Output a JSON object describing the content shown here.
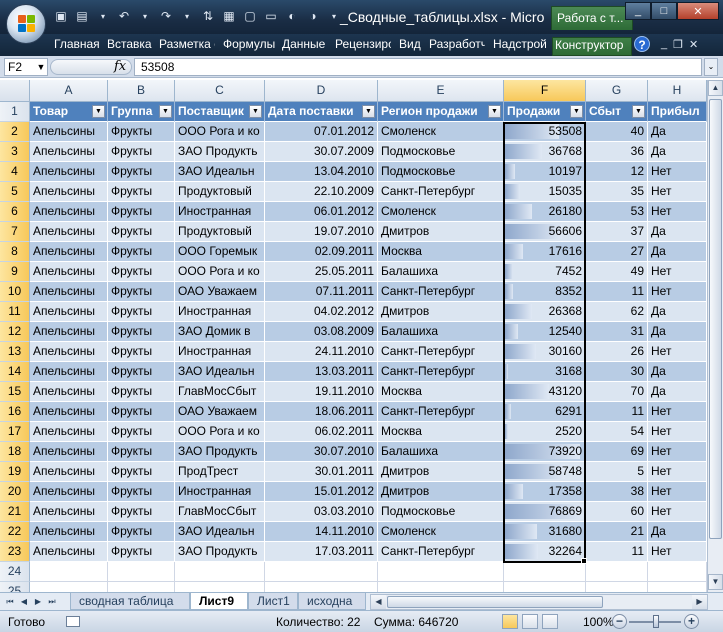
{
  "window": {
    "title": "_Сводные_таблицы.xlsx - Micro",
    "context_tab_title": "Работа с т..."
  },
  "ribbon": {
    "tabs": [
      "Главная",
      "Вставка",
      "Разметка с",
      "Формулы",
      "Данные",
      "Рецензиро",
      "Вид",
      "Разработч",
      "Надстрой",
      "Конструктор"
    ],
    "help": "?"
  },
  "formula_bar": {
    "name_box": "F2",
    "fx": "fx",
    "value": "53508"
  },
  "columns": [
    "A",
    "B",
    "C",
    "D",
    "E",
    "F",
    "G",
    "H"
  ],
  "table": {
    "headers": [
      "Товар",
      "Группа",
      "Поставщик",
      "Дата поставки",
      "Регион продажи",
      "Продажи",
      "Сбыт",
      "Прибыл"
    ],
    "rows": [
      [
        "Апельсины",
        "Фрукты",
        "ООО Рога и ко",
        "07.01.2012",
        "Смоленск",
        "53508",
        "40",
        "Да"
      ],
      [
        "Апельсины",
        "Фрукты",
        "ЗАО Продукть",
        "30.07.2009",
        "Подмосковье",
        "36768",
        "36",
        "Да"
      ],
      [
        "Апельсины",
        "Фрукты",
        "ЗАО Идеальн",
        "13.04.2010",
        "Подмосковье",
        "10197",
        "12",
        "Нет"
      ],
      [
        "Апельсины",
        "Фрукты",
        "Продуктовый",
        "22.10.2009",
        "Санкт-Петербург",
        "15035",
        "35",
        "Нет"
      ],
      [
        "Апельсины",
        "Фрукты",
        "Иностранная",
        "06.01.2012",
        "Смоленск",
        "26180",
        "53",
        "Нет"
      ],
      [
        "Апельсины",
        "Фрукты",
        "Продуктовый",
        "19.07.2010",
        "Дмитров",
        "56606",
        "37",
        "Да"
      ],
      [
        "Апельсины",
        "Фрукты",
        "ООО Горемык",
        "02.09.2011",
        "Москва",
        "17616",
        "27",
        "Да"
      ],
      [
        "Апельсины",
        "Фрукты",
        "ООО Рога и ко",
        "25.05.2011",
        "Балашиха",
        "7452",
        "49",
        "Нет"
      ],
      [
        "Апельсины",
        "Фрукты",
        "ОАО Уважаем",
        "07.11.2011",
        "Санкт-Петербург",
        "8352",
        "11",
        "Нет"
      ],
      [
        "Апельсины",
        "Фрукты",
        "Иностранная",
        "04.02.2012",
        "Дмитров",
        "26368",
        "62",
        "Да"
      ],
      [
        "Апельсины",
        "Фрукты",
        "ЗАО Домик в",
        "03.08.2009",
        "Балашиха",
        "12540",
        "31",
        "Да"
      ],
      [
        "Апельсины",
        "Фрукты",
        "Иностранная",
        "24.11.2010",
        "Санкт-Петербург",
        "30160",
        "26",
        "Нет"
      ],
      [
        "Апельсины",
        "Фрукты",
        "ЗАО Идеальн",
        "13.03.2011",
        "Санкт-Петербург",
        "3168",
        "30",
        "Да"
      ],
      [
        "Апельсины",
        "Фрукты",
        "ГлавМосСбыт",
        "19.11.2010",
        "Москва",
        "43120",
        "70",
        "Да"
      ],
      [
        "Апельсины",
        "Фрукты",
        "ОАО Уважаем",
        "18.06.2011",
        "Санкт-Петербург",
        "6291",
        "11",
        "Нет"
      ],
      [
        "Апельсины",
        "Фрукты",
        "ООО Рога и ко",
        "06.02.2011",
        "Москва",
        "2520",
        "54",
        "Нет"
      ],
      [
        "Апельсины",
        "Фрукты",
        "ЗАО Продукть",
        "30.07.2010",
        "Балашиха",
        "73920",
        "69",
        "Нет"
      ],
      [
        "Апельсины",
        "Фрукты",
        "ПродТрест",
        "30.01.2011",
        "Дмитров",
        "58748",
        "5",
        "Нет"
      ],
      [
        "Апельсины",
        "Фрукты",
        "Иностранная",
        "15.01.2012",
        "Дмитров",
        "17358",
        "38",
        "Нет"
      ],
      [
        "Апельсины",
        "Фрукты",
        "ГлавМосСбыт",
        "03.03.2010",
        "Подмосковье",
        "76869",
        "60",
        "Нет"
      ],
      [
        "Апельсины",
        "Фрукты",
        "ЗАО Идеальн",
        "14.11.2010",
        "Смоленск",
        "31680",
        "21",
        "Да"
      ],
      [
        "Апельсины",
        "Фрукты",
        "ЗАО Продукть",
        "17.03.2011",
        "Санкт-Петербург",
        "32264",
        "11",
        "Нет"
      ]
    ],
    "sales_max": 76869
  },
  "sheet_tabs": [
    "сводная таблица",
    "Лист9",
    "Лист1",
    "исходна"
  ],
  "active_sheet": "Лист9",
  "status": {
    "ready": "Готово",
    "count": "Количество: 22",
    "sum": "Сумма: 646720",
    "zoom": "100%"
  },
  "colors": {
    "header_fill": "#4f81bd",
    "band_light": "#dbe5f1",
    "band_dark": "#b8cce4",
    "selection_header": "#f7c85a"
  }
}
